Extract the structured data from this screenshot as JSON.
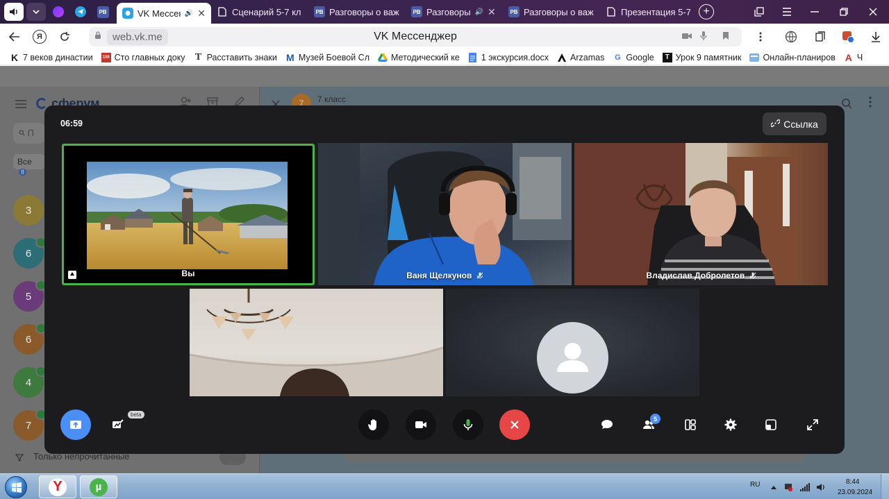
{
  "browser": {
    "tabs": [
      {
        "title": "VK Мессендж",
        "active": true
      },
      {
        "title": "Сценарий 5-7 кл"
      },
      {
        "title": "Разговоры о важ"
      },
      {
        "title": "Разговоры"
      },
      {
        "title": "Разговоры о важ"
      },
      {
        "title": "Презентация 5-7"
      }
    ],
    "tab_favicon_rv": "РВ",
    "address_host": "web.vk.me",
    "page_title": "VK Мессенджер",
    "bookmarks": [
      {
        "label": "7 веков династии",
        "icon": "K"
      },
      {
        "label": "Сто главных доку",
        "icon": "100"
      },
      {
        "label": "Расставить знаки",
        "icon": "T"
      },
      {
        "label": "Музей Боевой Сл",
        "icon": "M"
      },
      {
        "label": "Методический ке",
        "icon": "drive-icon"
      },
      {
        "label": "1 экскурсия.docx",
        "icon": "doc-icon"
      },
      {
        "label": "Arzamas",
        "icon": "arzamas-icon"
      },
      {
        "label": "Google",
        "icon": "G"
      },
      {
        "label": "Урок 9 памятник",
        "icon": "T"
      },
      {
        "label": "Онлайн-планиров",
        "icon": "planner-icon"
      },
      {
        "label": "Ч",
        "icon": "A"
      }
    ]
  },
  "sidebar": {
    "brand": "сферум",
    "search_placeholder": "П",
    "filter_all": "Все",
    "filter_all_count": "8",
    "chats": [
      {
        "initial": "3",
        "color": "#8a7a35"
      },
      {
        "initial": "6",
        "color": "#2d6d75"
      },
      {
        "initial": "5",
        "color": "#6b3a78"
      },
      {
        "initial": "6",
        "color": "#8a5a2a"
      },
      {
        "initial": "4",
        "color": "#3e7a3e"
      },
      {
        "initial": "7",
        "color": "#8a5a2a"
      }
    ],
    "unread_only": "Только непрочитанные"
  },
  "chat_header": {
    "avatar_initial": "7",
    "title": "7 класс"
  },
  "call": {
    "timer": "06:59",
    "link_button": "Ссылка",
    "participants": [
      {
        "name": "Вы"
      },
      {
        "name": "Ваня Щелкунов"
      },
      {
        "name": "Владислав Добролетов"
      }
    ],
    "beta_label": "beta",
    "participants_count": "5"
  },
  "taskbar": {
    "lang": "RU",
    "time": "8:44",
    "date": "23.09.2024"
  }
}
